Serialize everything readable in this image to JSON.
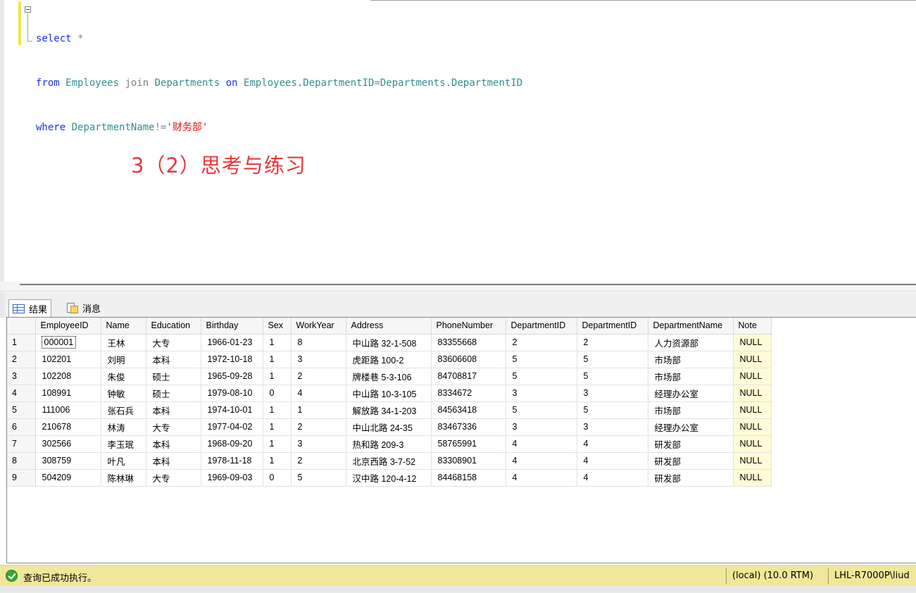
{
  "editor": {
    "line1": {
      "kw1": "select",
      "op1": " *"
    },
    "line2": {
      "kw1": "from",
      "obj1": " Employees ",
      "op1": "join",
      "obj2": " Departments ",
      "kw2": "on",
      "obj3": " Employees.DepartmentID",
      "op2": "=",
      "obj4": "Departments.DepartmentID"
    },
    "line3": {
      "kw1": "where",
      "obj1": " DepartmentName",
      "op1": "!=",
      "str1": "'财务部'"
    },
    "annotation": "3（2）思考与练习"
  },
  "result_tabs": {
    "results_label": "结果",
    "messages_label": "消息"
  },
  "grid": {
    "columns": [
      "",
      "EmployeeID",
      "Name",
      "Education",
      "Birthday",
      "Sex",
      "WorkYear",
      "Address",
      "PhoneNumber",
      "DepartmentID",
      "DepartmentID",
      "DepartmentName",
      "Note"
    ],
    "rows": [
      [
        "1",
        "000001",
        "王林",
        "大专",
        "1966-01-23",
        "1",
        "8",
        "中山路 32-1-508",
        "83355668",
        "2",
        "2",
        "人力资源部",
        "NULL"
      ],
      [
        "2",
        "102201",
        "刘明",
        "本科",
        "1972-10-18",
        "1",
        "3",
        "虎距路 100-2",
        "83606608",
        "5",
        "5",
        "市场部",
        "NULL"
      ],
      [
        "3",
        "102208",
        "朱俊",
        "硕士",
        "1965-09-28",
        "1",
        "2",
        "牌楼巷 5-3-106",
        "84708817",
        "5",
        "5",
        "市场部",
        "NULL"
      ],
      [
        "4",
        "108991",
        "钟敏",
        "硕士",
        "1979-08-10",
        "0",
        "4",
        "中山路 10-3-105",
        "8334672",
        "3",
        "3",
        "经理办公室",
        "NULL"
      ],
      [
        "5",
        "111006",
        "张石兵",
        "本科",
        "1974-10-01",
        "1",
        "1",
        "解放路 34-1-203",
        "84563418",
        "5",
        "5",
        "市场部",
        "NULL"
      ],
      [
        "6",
        "210678",
        "林涛",
        "大专",
        "1977-04-02",
        "1",
        "2",
        "中山北路 24-35",
        "83467336",
        "3",
        "3",
        "经理办公室",
        "NULL"
      ],
      [
        "7",
        "302566",
        "李玉珉",
        "本科",
        "1968-09-20",
        "1",
        "3",
        "热和路 209-3",
        "58765991",
        "4",
        "4",
        "研发部",
        "NULL"
      ],
      [
        "8",
        "308759",
        "叶凡",
        "本科",
        "1978-11-18",
        "1",
        "2",
        "北京西路 3-7-52",
        "83308901",
        "4",
        "4",
        "研发部",
        "NULL"
      ],
      [
        "9",
        "504209",
        "陈林琳",
        "大专",
        "1969-09-03",
        "0",
        "5",
        "汉中路 120-4-12",
        "84468158",
        "4",
        "4",
        "研发部",
        "NULL"
      ]
    ]
  },
  "status": {
    "message": "查询已成功执行。",
    "server": "(local) (10.0 RTM)",
    "user": "LHL-R7000P\\liud",
    "bar_color": "#f0e79a"
  }
}
